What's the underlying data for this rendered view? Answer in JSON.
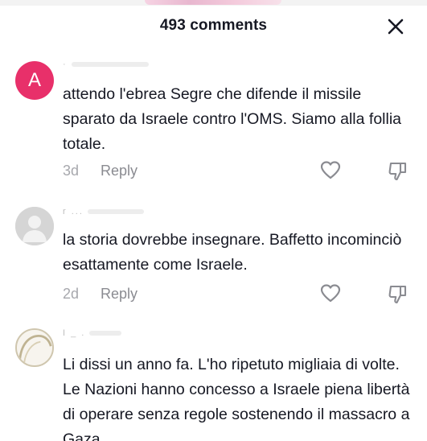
{
  "header": {
    "comment_count": "493 comments"
  },
  "comments": [
    {
      "avatar_letter": "A",
      "username": "·",
      "text": "attendo l'ebrea Segre che difende il missile sparato da Israele contro l'OMS. Siamo alla follia totale.",
      "date": "3d",
      "reply_label": "Reply"
    },
    {
      "avatar_letter": "",
      "username": "r ...",
      "text": "la storia dovrebbe insegnare. Baffetto incominciò esattamente come Israele.",
      "date": "2d",
      "reply_label": "Reply"
    },
    {
      "avatar_letter": "",
      "username": "I _ .",
      "text": "Li dissi un anno fa. L'ho ripetuto migliaia di volte. Le Nazioni hanno concesso a Israele piena libertà di operare senza regole sostenendo il massacro a Gaza"
    }
  ],
  "icons": {
    "close": "close-icon",
    "like": "heart-outline-icon",
    "dislike": "thumbs-down-icon"
  },
  "colors": {
    "avatar_a": "#e8306a",
    "text_primary": "#161823",
    "text_secondary": "#8a8b91"
  }
}
